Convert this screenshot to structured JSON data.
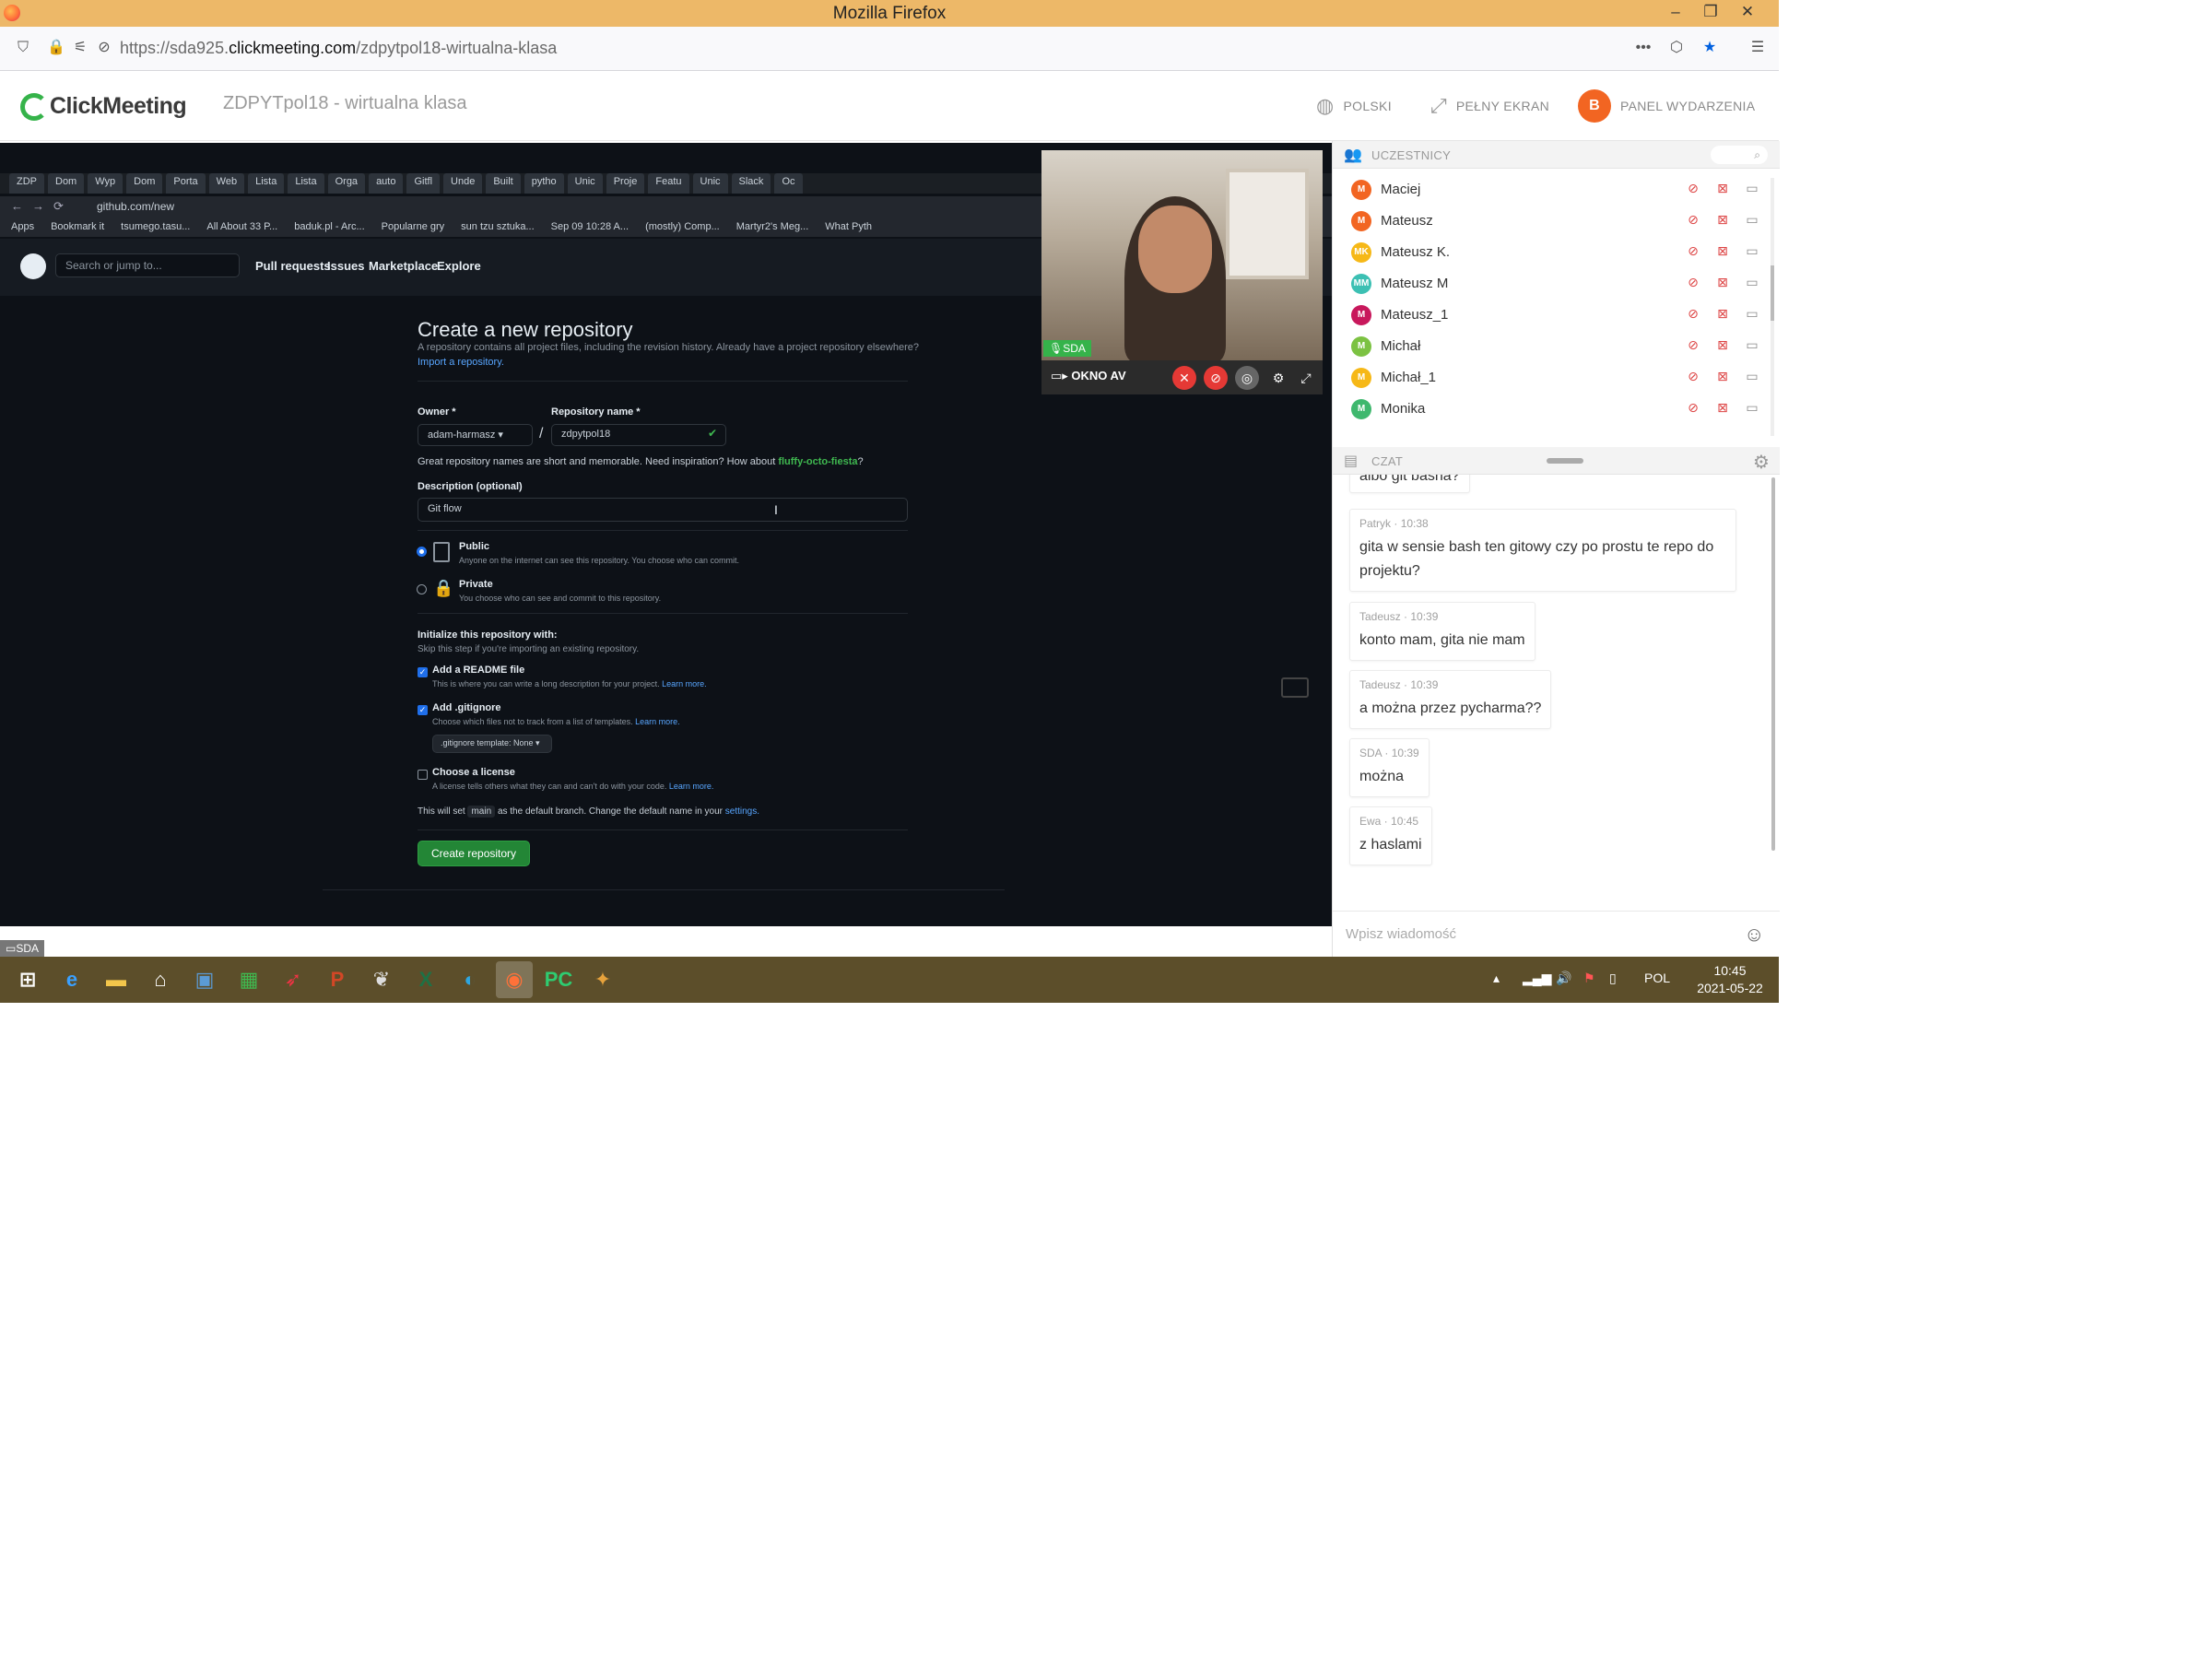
{
  "window": {
    "title": "Mozilla Firefox",
    "controls": [
      "–",
      "❐",
      "✕"
    ]
  },
  "address_bar": {
    "url_prefix": "https://sda925.",
    "url_domain": "clickmeeting.com",
    "url_path": "/zdpytpol18-wirtualna-klasa"
  },
  "header": {
    "logo_text": "ClickMeeting",
    "room_title": "ZDPYTpol18 - wirtualna klasa",
    "language_label": "POLSKI",
    "fullscreen_label": "PEŁNY EKRAN",
    "panel_label": "PANEL WYDARZENIA",
    "panel_avatar": "B"
  },
  "shared_screen": {
    "tabs": [
      "ZDP",
      "Dom",
      "Wyp",
      "Dom",
      "Porta",
      "Web",
      "Lista",
      "Lista",
      "Orga",
      "auto",
      "Gitfl",
      "Unde",
      "Built",
      "pytho",
      "Unic",
      "Proje",
      "Featu",
      "Unic",
      "Slack",
      "Oc"
    ],
    "url": "github.com/new",
    "bookmarks": [
      "Apps",
      "Bookmark it",
      "tsumego.tasu...",
      "All About 33 P...",
      "baduk.pl - Arc...",
      "Popularne gry",
      "sun tzu sztuka...",
      "Sep 09 10:28 A...",
      "(mostly) Comp...",
      "Martyr2's Meg...",
      "What Pyth"
    ],
    "search_placeholder": "Search or jump to...",
    "nav": [
      "Pull requests",
      "Issues",
      "Marketplace",
      "Explore"
    ],
    "heading": "Create a new repository",
    "subheading": "A repository contains all project files, including the revision history. Already have a project repository elsewhere?",
    "import_link": "Import a repository.",
    "owner_label": "Owner *",
    "owner_value": "adam-harmasz ▾",
    "slash": "/",
    "repo_label": "Repository name *",
    "repo_value": "zdpytpol18",
    "name_hint_prefix": "Great repository names are short and memorable. Need inspiration? How about ",
    "name_hint_suggestion": "fluffy-octo-fiesta",
    "description_label": "Description (optional)",
    "description_value": "Git flow",
    "public_label": "Public",
    "public_desc": "Anyone on the internet can see this repository. You choose who can commit.",
    "private_label": "Private",
    "private_desc": "You choose who can see and commit to this repository.",
    "init_label": "Initialize this repository with:",
    "init_desc": "Skip this step if you're importing an existing repository.",
    "readme_label": "Add a README file",
    "readme_desc": "This is where you can write a long description for your project.",
    "gitignore_label": "Add .gitignore",
    "gitignore_desc": "Choose which files not to track from a list of templates.",
    "gitignore_template": ".gitignore template: None ▾",
    "license_label": "Choose a license",
    "license_desc": "A license tells others what they can and can't do with your code.",
    "learn_more": "Learn more.",
    "branch_prefix": "This will set",
    "branch_name": "main",
    "branch_suffix": "as the default branch. Change the default name in your",
    "settings_link": "settings.",
    "create_button": "Create repository"
  },
  "av_window": {
    "name_tag": "SDA",
    "label": "OKNO AV"
  },
  "participants": {
    "title": "UCZESTNICY",
    "list": [
      {
        "initials": "M",
        "name": "Maciej",
        "color": "#f26522"
      },
      {
        "initials": "M",
        "name": "Mateusz",
        "color": "#f26522"
      },
      {
        "initials": "MK",
        "name": "Mateusz K.",
        "color": "#f6b817"
      },
      {
        "initials": "MM",
        "name": "Mateusz M",
        "color": "#3cc0b3"
      },
      {
        "initials": "M",
        "name": "Mateusz_1",
        "color": "#c8185c"
      },
      {
        "initials": "M",
        "name": "Michał",
        "color": "#7cc242"
      },
      {
        "initials": "M",
        "name": "Michał_1",
        "color": "#f6b817"
      },
      {
        "initials": "M",
        "name": "Monika",
        "color": "#3fb86e"
      }
    ]
  },
  "chat": {
    "title": "CZAT",
    "partial_top": "albo git basha?",
    "messages": [
      {
        "author": "Patryk",
        "time": "10:38",
        "text": "gita w sensie bash ten gitowy czy po prostu te repo do projektu?"
      },
      {
        "author": "Tadeusz",
        "time": "10:39",
        "text": "konto mam, gita nie mam"
      },
      {
        "author": "Tadeusz",
        "time": "10:39",
        "text": "a można przez pycharma??"
      },
      {
        "author": "SDA",
        "time": "10:39",
        "text": "można"
      },
      {
        "author": "Ewa",
        "time": "10:45",
        "text": "z haslami"
      }
    ],
    "input_placeholder": "Wpisz wiadomość"
  },
  "bottom_tag": "SDA",
  "taskbar": {
    "language": "POL",
    "time": "10:45",
    "date": "2021-05-22",
    "apps": [
      "start",
      "internet-explorer",
      "file-explorer",
      "home",
      "lenovo",
      "store",
      "rocket",
      "powerpoint",
      "feather",
      "excel",
      "edge",
      "firefox",
      "pycharm",
      "game"
    ]
  },
  "colors": {
    "titlebar": "#edb868",
    "brand_green": "#35b34a",
    "accent_orange": "#f26522",
    "taskbar": "#5c4e2a"
  }
}
